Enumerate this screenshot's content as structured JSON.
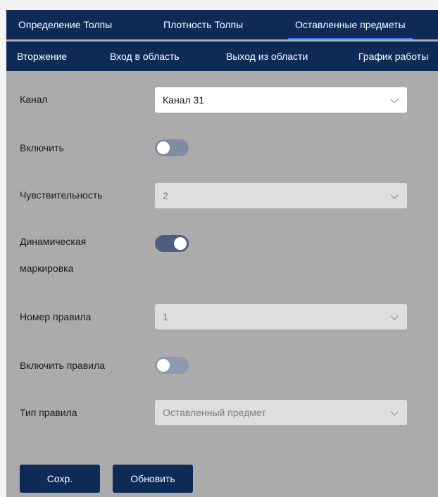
{
  "tabs_row1": [
    {
      "label": "Определение Толпы",
      "active": false
    },
    {
      "label": "Плотность Толпы",
      "active": false
    },
    {
      "label": "Оставленные предметы",
      "active": true
    }
  ],
  "tabs_row2": [
    {
      "label": "Вторжение"
    },
    {
      "label": "Вход в область"
    },
    {
      "label": "Выход из области"
    },
    {
      "label": "График работы"
    }
  ],
  "form": {
    "channel": {
      "label": "Канал",
      "value": "Канал 31",
      "enabled": true
    },
    "enable": {
      "label": "Включить",
      "checked": false
    },
    "sensitivity": {
      "label": "Чувствительность",
      "value": "2",
      "enabled": false
    },
    "dynamic_marking": {
      "label_line1": "Динамическая",
      "label_line2": "маркировка",
      "checked": true
    },
    "rule_number": {
      "label": "Номер правила",
      "value": "1",
      "enabled": false
    },
    "enable_rules": {
      "label": "Включить правила",
      "checked": false
    },
    "rule_type": {
      "label": "Тип правила",
      "value": "Оставленный предмет",
      "enabled": false
    }
  },
  "buttons": {
    "save": "Сохр.",
    "refresh": "Обновить"
  },
  "colors": {
    "header_bg": "#0e2a57",
    "active_underline": "#2f7dff",
    "panel_bg": "#ababab",
    "toggle_on": "#4c5f80",
    "toggle_off": "#8e9ab0"
  },
  "icons": {
    "dropdown": "chevron-down-icon"
  }
}
